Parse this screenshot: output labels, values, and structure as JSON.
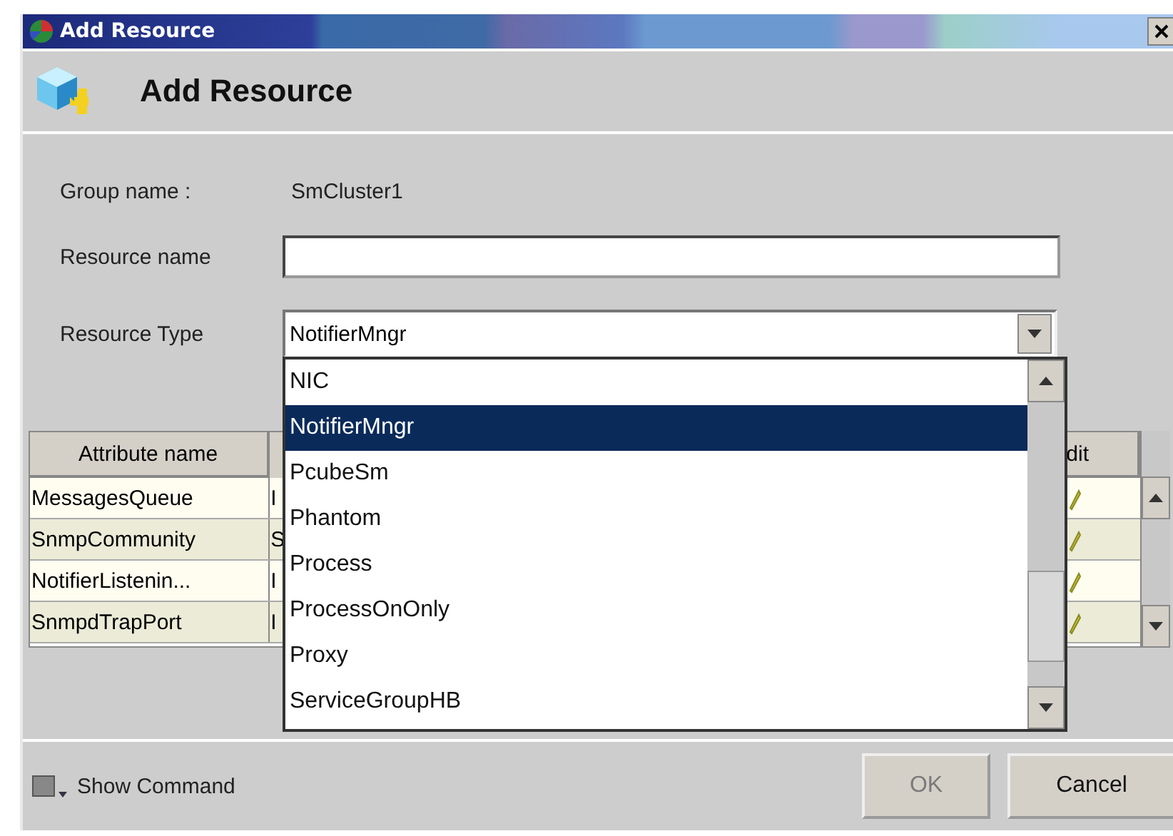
{
  "window": {
    "title": "Add Resource"
  },
  "header": {
    "title": "Add Resource"
  },
  "form": {
    "group_label": "Group name :",
    "group_value": "SmCluster1",
    "resource_name_label": "Resource name",
    "resource_type_label": "Resource Type",
    "resource_type_value": "NotifierMngr"
  },
  "table": {
    "columns": [
      "Attribute name",
      "dit"
    ],
    "rows": [
      {
        "name": "MessagesQueue",
        "column_2": "I"
      },
      {
        "name": "SnmpCommunity",
        "column_2": "S"
      },
      {
        "name": "NotifierListenin...",
        "column_2": "I"
      },
      {
        "name": "SnmpdTrapPort",
        "column_2": "I"
      }
    ]
  },
  "dropdown": {
    "items": [
      {
        "label": "NIC",
        "selected": false
      },
      {
        "label": "NotifierMngr",
        "selected": true
      },
      {
        "label": "PcubeSm",
        "selected": false
      },
      {
        "label": "Phantom",
        "selected": false
      },
      {
        "label": "Process",
        "selected": false
      },
      {
        "label": "ProcessOnOnly",
        "selected": false
      },
      {
        "label": "Proxy",
        "selected": false
      },
      {
        "label": "ServiceGroupHB",
        "selected": false
      }
    ]
  },
  "footer": {
    "show_command": "Show Command",
    "buttons": [
      {
        "label": "OK",
        "disabled": true
      },
      {
        "label": "Cancel",
        "disabled": false
      }
    ]
  }
}
